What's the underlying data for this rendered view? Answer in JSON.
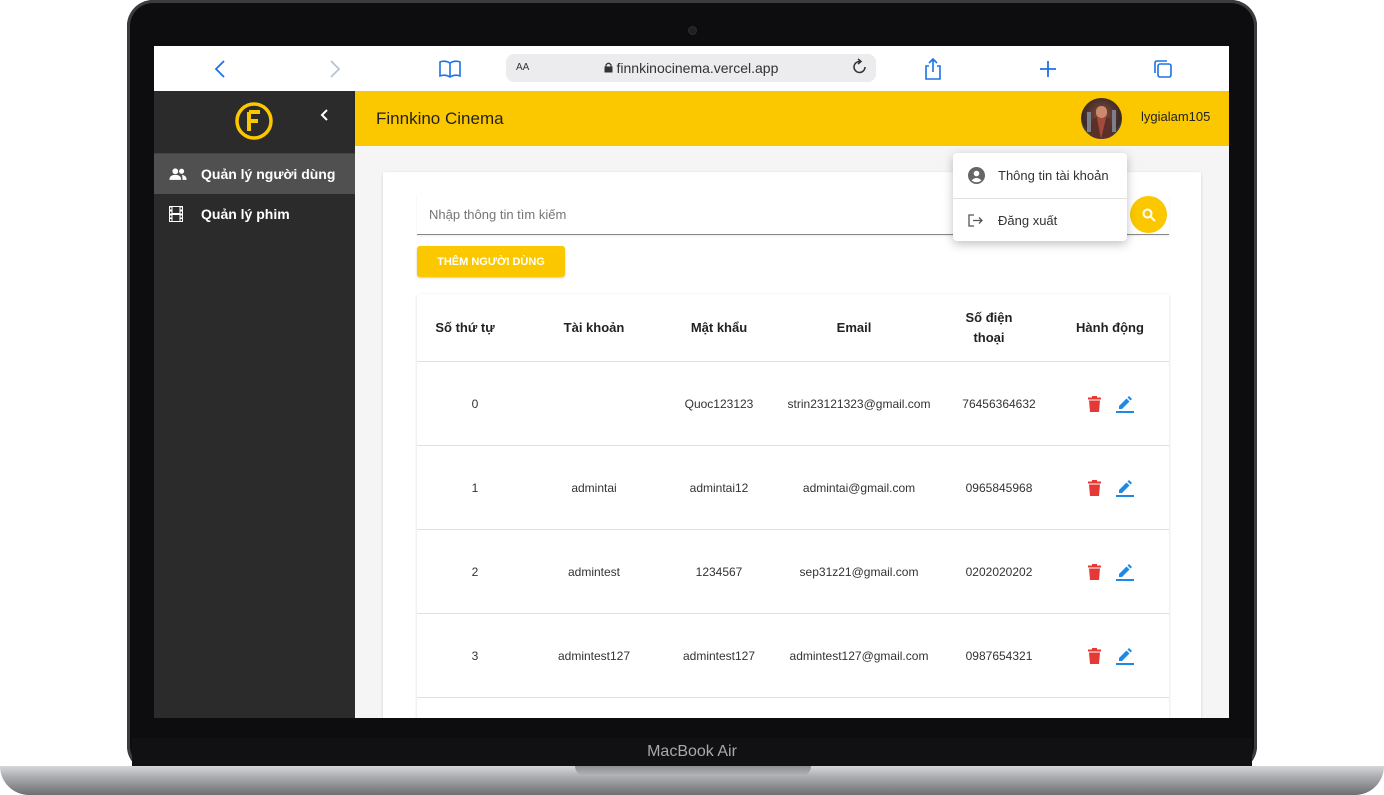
{
  "device": {
    "label": "MacBook Air"
  },
  "browser": {
    "text_size_label": "AA",
    "url": "finnkinocinema.vercel.app"
  },
  "colors": {
    "accent": "#fbc800",
    "sidebar": "#2b2b2b",
    "delete": "#e53935",
    "edit": "#1e88e5"
  },
  "sidebar": {
    "items": [
      {
        "label": "Quản lý người dùng",
        "icon": "people-icon",
        "active": true
      },
      {
        "label": "Quản lý phim",
        "icon": "film-icon",
        "active": false
      }
    ]
  },
  "topbar": {
    "title": "Finnkino Cinema",
    "username": "lygialam105"
  },
  "user_menu": {
    "items": [
      {
        "label": "Thông tin tài khoản",
        "icon": "account-circle-icon"
      },
      {
        "label": "Đăng xuất",
        "icon": "logout-icon"
      }
    ]
  },
  "search": {
    "placeholder": "Nhập thông tin tìm kiếm"
  },
  "add_button": {
    "label": "THÊM NGƯỜI DÙNG"
  },
  "table": {
    "columns": [
      "Số thứ tự",
      "Tài khoản",
      "Mật khẩu",
      "Email",
      "Số điện thoại",
      "Hành động"
    ],
    "phone_header_line1": "Số điện",
    "phone_header_line2": "thoại",
    "rows": [
      {
        "index": "0",
        "account": "",
        "password": "Quoc123123",
        "email": "strin23121323@gmail.com",
        "phone": "76456364632"
      },
      {
        "index": "1",
        "account": "admintai",
        "password": "admintai12",
        "email": "admintai@gmail.com",
        "phone": "0965845968"
      },
      {
        "index": "2",
        "account": "admintest",
        "password": "1234567",
        "email": "sep31z21@gmail.com",
        "phone": "0202020202"
      },
      {
        "index": "3",
        "account": "admintest127",
        "password": "admintest127",
        "email": "admintest127@gmail.com",
        "phone": "0987654321"
      }
    ]
  }
}
